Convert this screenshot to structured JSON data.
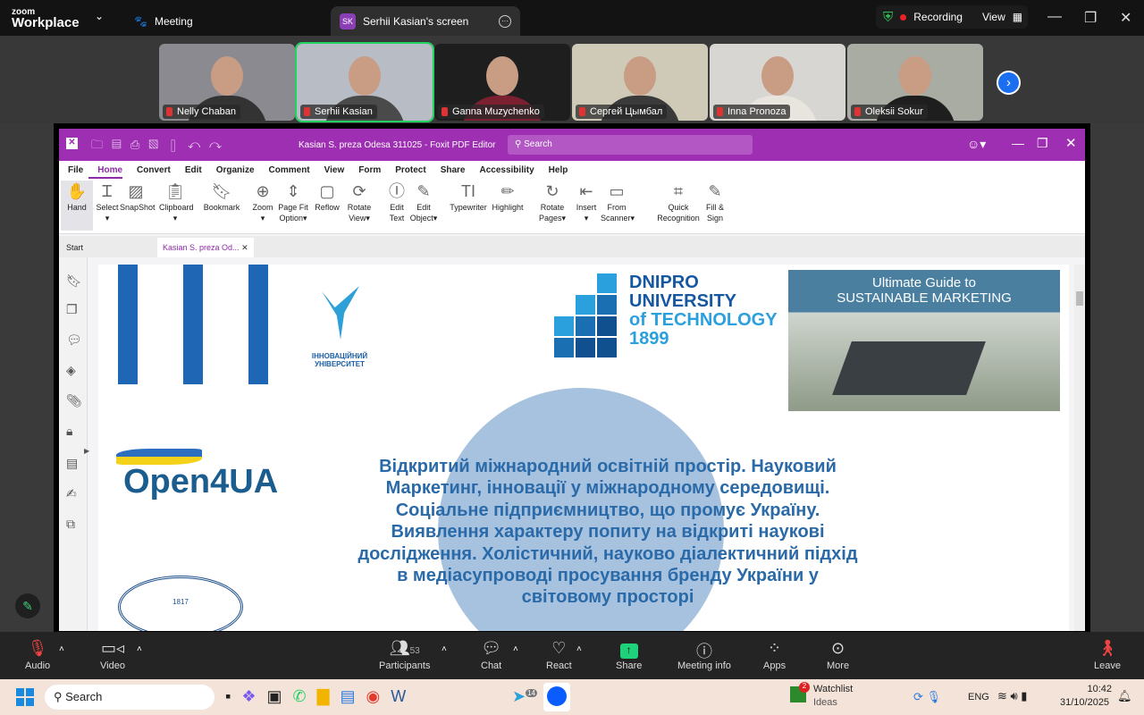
{
  "zoom": {
    "logo_small": "zoom",
    "logo_big": "Workplace",
    "meeting_tab": "Meeting",
    "screen_tab": "Serhii Kasian's screen",
    "sk_initials": "SK",
    "recording": "Recording",
    "view": "View"
  },
  "participants": [
    {
      "name": "Nelly Chaban",
      "bg": "#8a8a90",
      "shirt": "#333"
    },
    {
      "name": "Serhii Kasian",
      "bg": "#b8bcc4",
      "shirt": "#4a4a4a",
      "active": true
    },
    {
      "name": "Ganna Muzychenko",
      "bg": "#1e1e1e",
      "shirt": "#7b2030"
    },
    {
      "name": "Сергей Цымбал",
      "bg": "#cfcab8",
      "shirt": "#3a3a3a"
    },
    {
      "name": "Inna Pronoza",
      "bg": "#d8d6d2",
      "shirt": "#e8e4de"
    },
    {
      "name": "Oleksii Sokur",
      "bg": "#a8aca2",
      "shirt": "#1e1e1e"
    }
  ],
  "foxit": {
    "title": "Kasian S. preza  Odesa 311025 - Foxit PDF Editor",
    "search_placeholder": "Search",
    "menu": [
      "File",
      "Home",
      "Convert",
      "Edit",
      "Organize",
      "Comment",
      "View",
      "Form",
      "Protect",
      "Share",
      "Accessibility",
      "Help"
    ],
    "ribbon": [
      [
        "Hand",
        ""
      ],
      [
        "Select",
        "▾"
      ],
      [
        "SnapShot",
        ""
      ],
      [
        "Clipboard",
        "▾"
      ],
      [
        "Bookmark",
        ""
      ],
      [
        "Zoom",
        "▾"
      ],
      [
        "Page Fit",
        "Option▾"
      ],
      [
        "Reflow",
        ""
      ],
      [
        "Rotate",
        "View▾"
      ],
      [
        "Edit",
        "Text"
      ],
      [
        "Edit",
        "Object▾"
      ],
      [
        "Typewriter",
        ""
      ],
      [
        "Highlight",
        ""
      ],
      [
        "Rotate",
        "Pages▾"
      ],
      [
        "Insert",
        "▾"
      ],
      [
        "From",
        "Scanner▾"
      ],
      [
        "Quick",
        "Recognition"
      ],
      [
        "Fill &",
        "Sign"
      ]
    ],
    "tabs": [
      "Start",
      "Kasian S. preza  Od..."
    ],
    "accent": "#9e2fb3"
  },
  "slide": {
    "innov_logo": "ІННОВАЦІЙНИЙ УНІВЕРСИТЕТ",
    "dnipro": [
      "DNIPRO",
      "UNIVERSITY",
      "of TECHNOLOGY",
      "1899"
    ],
    "guide": [
      "Ultimate Guide to",
      "SUSTAINABLE MARKETING"
    ],
    "open4ua": "Open4UA",
    "seal_year": "1817",
    "lines": [
      "Відкритий міжнародний освітній простір. Науковий",
      "Маркетинг, інновації у міжнародному середовищі.",
      "Соціальне підприємництво, що промує Україну.",
      "Виявлення характеру попиту на відкриті наукові",
      "дослідження. Холістичний, науково діалектичний  підхід",
      "в медіасупроводі просування бренду України у",
      "світовому просторі"
    ]
  },
  "toolbar": {
    "audio": "Audio",
    "video": "Video",
    "participants": "Participants",
    "participants_count": "53",
    "chat": "Chat",
    "react": "React",
    "share": "Share",
    "meeting_info": "Meeting info",
    "apps": "Apps",
    "more": "More",
    "leave": "Leave"
  },
  "taskbar": {
    "search": "Search",
    "watchlist": "Watchlist",
    "ideas": "Ideas",
    "badge": "2",
    "telegram_badge": "14",
    "lang": "ENG",
    "time": "10:42",
    "date": "31/10/2025"
  }
}
